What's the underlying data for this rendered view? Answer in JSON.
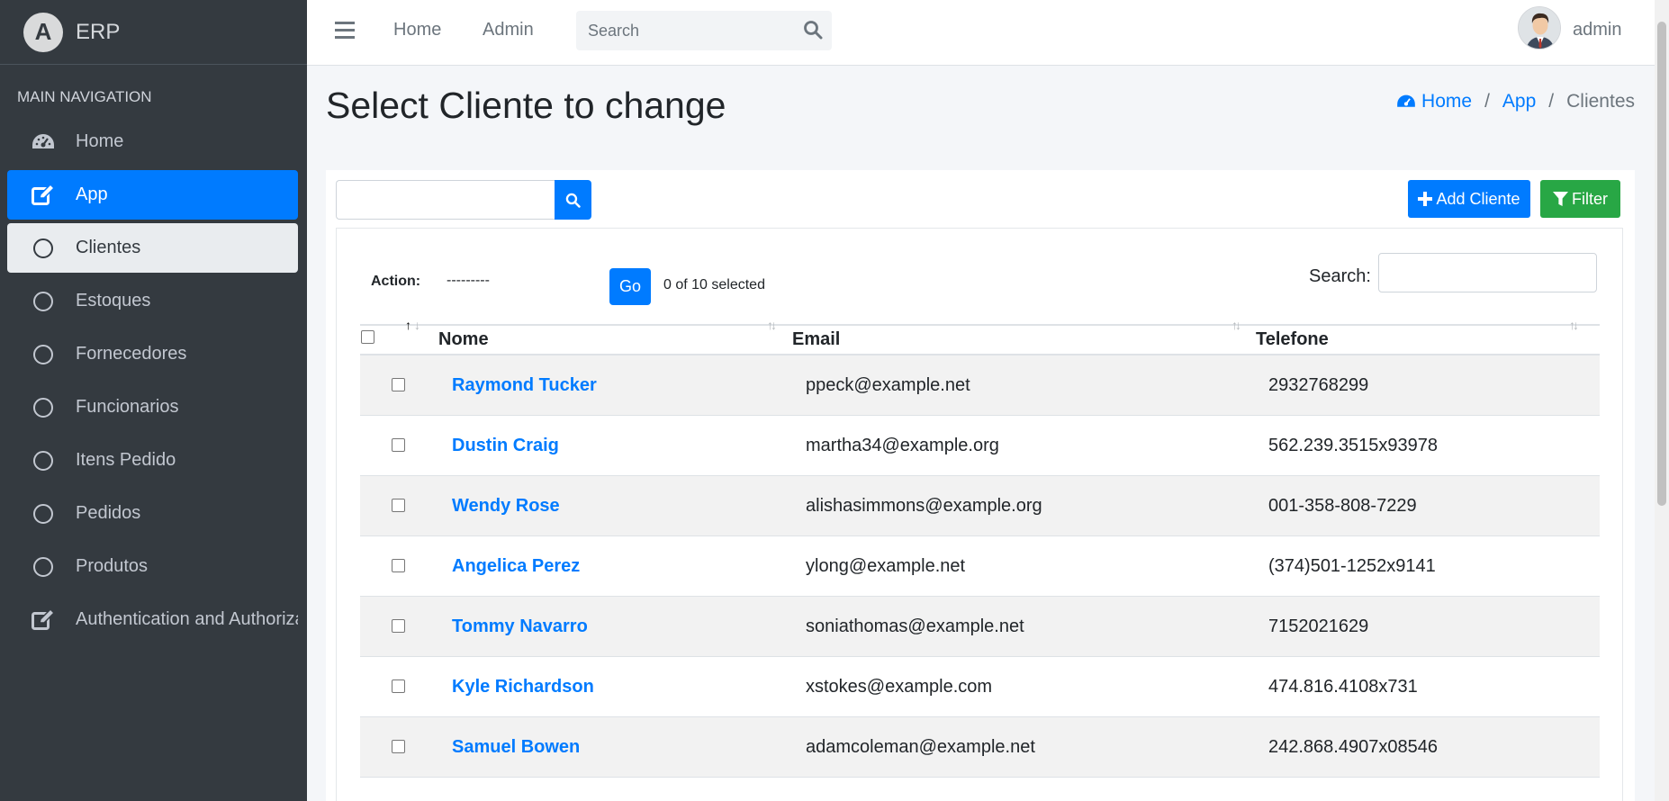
{
  "brand": {
    "letter": "A",
    "name": "ERP"
  },
  "sidebar": {
    "header": "MAIN NAVIGATION",
    "items": [
      {
        "label": "Home",
        "icon": "dashboard-icon"
      },
      {
        "label": "App",
        "icon": "edit-icon"
      },
      {
        "label": "Clientes",
        "icon": "circle-icon"
      },
      {
        "label": "Estoques",
        "icon": "circle-icon"
      },
      {
        "label": "Fornecedores",
        "icon": "circle-icon"
      },
      {
        "label": "Funcionarios",
        "icon": "circle-icon"
      },
      {
        "label": "Itens Pedido",
        "icon": "circle-icon"
      },
      {
        "label": "Pedidos",
        "icon": "circle-icon"
      },
      {
        "label": "Produtos",
        "icon": "circle-icon"
      },
      {
        "label": "Authentication and Authorization",
        "icon": "edit-icon"
      }
    ]
  },
  "topbar": {
    "links": [
      "Home",
      "Admin"
    ],
    "search_placeholder": "Search",
    "user": "admin"
  },
  "page": {
    "title": "Select Cliente to change",
    "breadcrumb": [
      "Home",
      "App",
      "Clientes"
    ]
  },
  "toolbar": {
    "add_label": "Add Cliente",
    "filter_label": "Filter"
  },
  "actions": {
    "label": "Action:",
    "selected_value": "---------",
    "go_label": "Go",
    "selected_count": "0 of 10 selected",
    "search_label": "Search:"
  },
  "table": {
    "columns": [
      "Nome",
      "Email",
      "Telefone"
    ],
    "rows": [
      {
        "nome": "Raymond Tucker",
        "email": "ppeck@example.net",
        "telefone": "2932768299"
      },
      {
        "nome": "Dustin Craig",
        "email": "martha34@example.org",
        "telefone": "562.239.3515x93978"
      },
      {
        "nome": "Wendy Rose",
        "email": "alishasimmons@example.org",
        "telefone": "001-358-808-7229"
      },
      {
        "nome": "Angelica Perez",
        "email": "ylong@example.net",
        "telefone": "(374)501-1252x9141"
      },
      {
        "nome": "Tommy Navarro",
        "email": "soniathomas@example.net",
        "telefone": "7152021629"
      },
      {
        "nome": "Kyle Richardson",
        "email": "xstokes@example.com",
        "telefone": "474.816.4108x731"
      },
      {
        "nome": "Samuel Bowen",
        "email": "adamcoleman@example.net",
        "telefone": "242.868.4907x08546"
      }
    ]
  },
  "colors": {
    "sidebar_bg": "#343a40",
    "primary": "#007bff",
    "success": "#28a745",
    "content_bg": "#f4f6f9"
  }
}
